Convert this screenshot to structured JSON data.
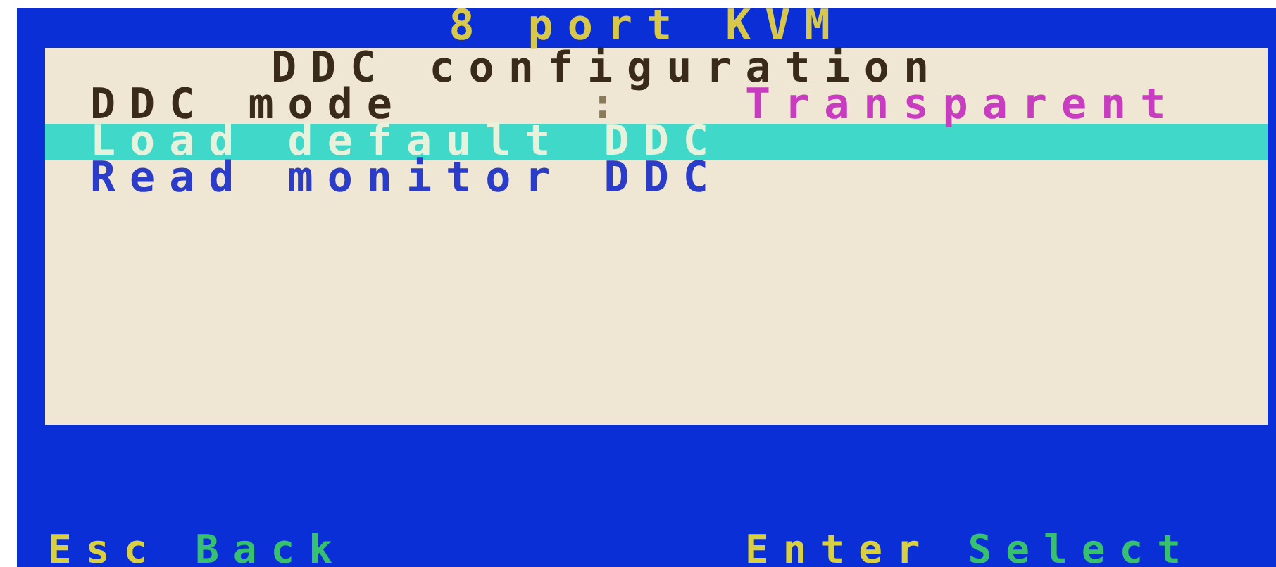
{
  "header": {
    "title": "8 port KVM"
  },
  "panel": {
    "title": "DDC configuration",
    "items": [
      {
        "kind": "setting",
        "label": "DDC mode",
        "separator": ":",
        "value": "Transparent"
      },
      {
        "kind": "action",
        "label": "Load default DDC",
        "selected": true
      },
      {
        "kind": "action",
        "label": "Read monitor DDC",
        "selected": false
      }
    ]
  },
  "footer": [
    {
      "key": "Esc",
      "action": "Back"
    },
    {
      "key": "Enter",
      "action": "Select"
    }
  ]
}
